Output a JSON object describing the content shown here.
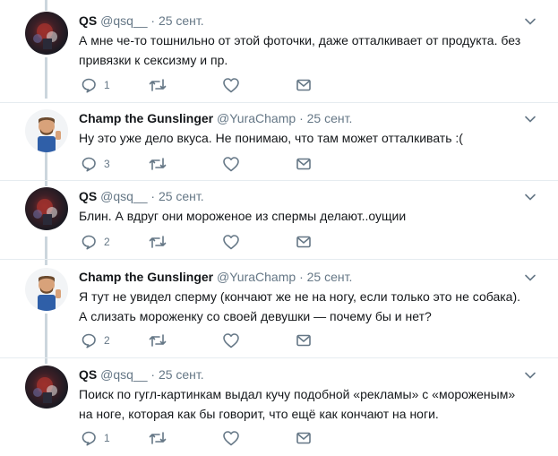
{
  "tweets": [
    {
      "name": "QS",
      "handle": "@qsq__",
      "dot": "·",
      "date": "25 сент.",
      "text": "А мне че-то тошнильно от этой фоточки, даже отталкивает от продукта. без привязки к сексизму и пр.",
      "reply_count": "1",
      "avatar_icon": "qs-avatar"
    },
    {
      "name": "Champ the Gunslinger",
      "handle": "@YuraChamp",
      "dot": "·",
      "date": "25 сент.",
      "text": "Ну это уже дело вкуса. Не понимаю, что там может отталкивать :(",
      "reply_count": "3",
      "avatar_icon": "champ-avatar"
    },
    {
      "name": "QS",
      "handle": "@qsq__",
      "dot": "·",
      "date": "25 сент.",
      "text": "Блин. А вдруг они мороженое из спермы делают..оущии",
      "reply_count": "2",
      "avatar_icon": "qs-avatar"
    },
    {
      "name": "Champ the Gunslinger",
      "handle": "@YuraChamp",
      "dot": "·",
      "date": "25 сент.",
      "text": "Я тут не увидел сперму (кончают же не на ногу, если только это не собака). А слизать мороженку со своей девушки — почему бы и нет?",
      "reply_count": "2",
      "avatar_icon": "champ-avatar"
    },
    {
      "name": "QS",
      "handle": "@qsq__",
      "dot": "·",
      "date": "25 сент.",
      "text": "Поиск по гугл-картинкам выдал кучу подобной «рекламы» с «мороженым» на ноге, которая как бы говорит, что ещё как кончают на ноги.",
      "reply_count": "1",
      "avatar_icon": "qs-avatar"
    }
  ],
  "colors": {
    "text": "#14171a",
    "muted": "#657786",
    "thread_line": "#ccd6dd",
    "separator": "#e6ecf0"
  }
}
